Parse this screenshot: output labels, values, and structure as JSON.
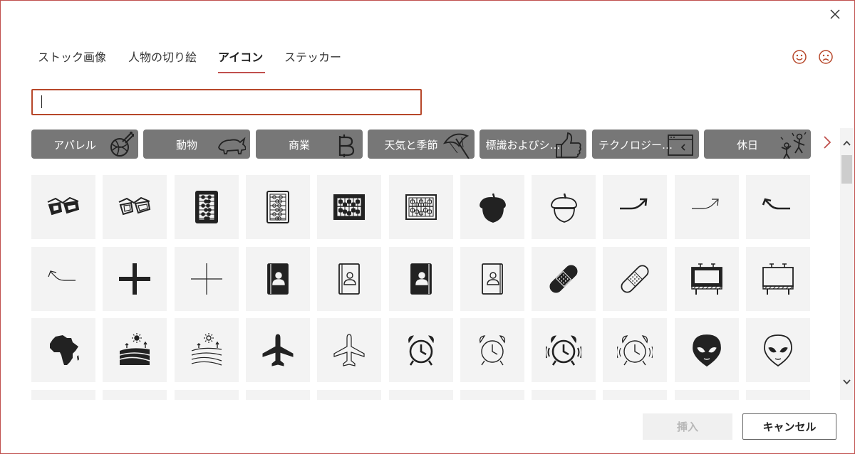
{
  "tabs": [
    {
      "label": "ストック画像",
      "active": false
    },
    {
      "label": "人物の切り絵",
      "active": false
    },
    {
      "label": "アイコン",
      "active": true
    },
    {
      "label": "ステッカー",
      "active": false
    }
  ],
  "search": {
    "value": "",
    "placeholder": ""
  },
  "categories": [
    {
      "label": "アパレル",
      "icon": "yarn-icon"
    },
    {
      "label": "動物",
      "icon": "rhino-icon"
    },
    {
      "label": "商業",
      "icon": "bitcoin-icon"
    },
    {
      "label": "天気と季節",
      "icon": "umbrella-icon"
    },
    {
      "label": "標識およびシ…",
      "icon": "thumbs-up-icon"
    },
    {
      "label": "テクノロジー…",
      "icon": "code-window-icon"
    },
    {
      "label": "休日",
      "icon": "celebration-icon"
    }
  ],
  "icons": [
    [
      "3d-glasses",
      "3d-glasses-outline",
      "abacus",
      "abacus-outline",
      "abacus-frame",
      "abacus-frame-outline",
      "acorn",
      "acorn-outline",
      "arrow-right-curve",
      "arrow-right-curve-outline",
      "arrow-left-curve"
    ],
    [
      "arrow-left-curve-outline",
      "plus",
      "plus-outline",
      "address-book",
      "address-book-outline",
      "address-book-alt",
      "address-book-alt-outline",
      "bandage",
      "bandage-outline",
      "billboard",
      "billboard-outline"
    ],
    [
      "africa",
      "farm",
      "farm-outline",
      "airplane",
      "airplane-outline",
      "alarm-clock",
      "alarm-clock-outline",
      "alarm-ringing",
      "alarm-ringing-outline",
      "alien",
      "alien-outline"
    ]
  ],
  "buttons": {
    "insert": "挿入",
    "cancel": "キャンセル"
  },
  "colors": {
    "accent": "#c0504d",
    "chip_bg": "#777777",
    "cell_bg": "#f3f3f3"
  }
}
